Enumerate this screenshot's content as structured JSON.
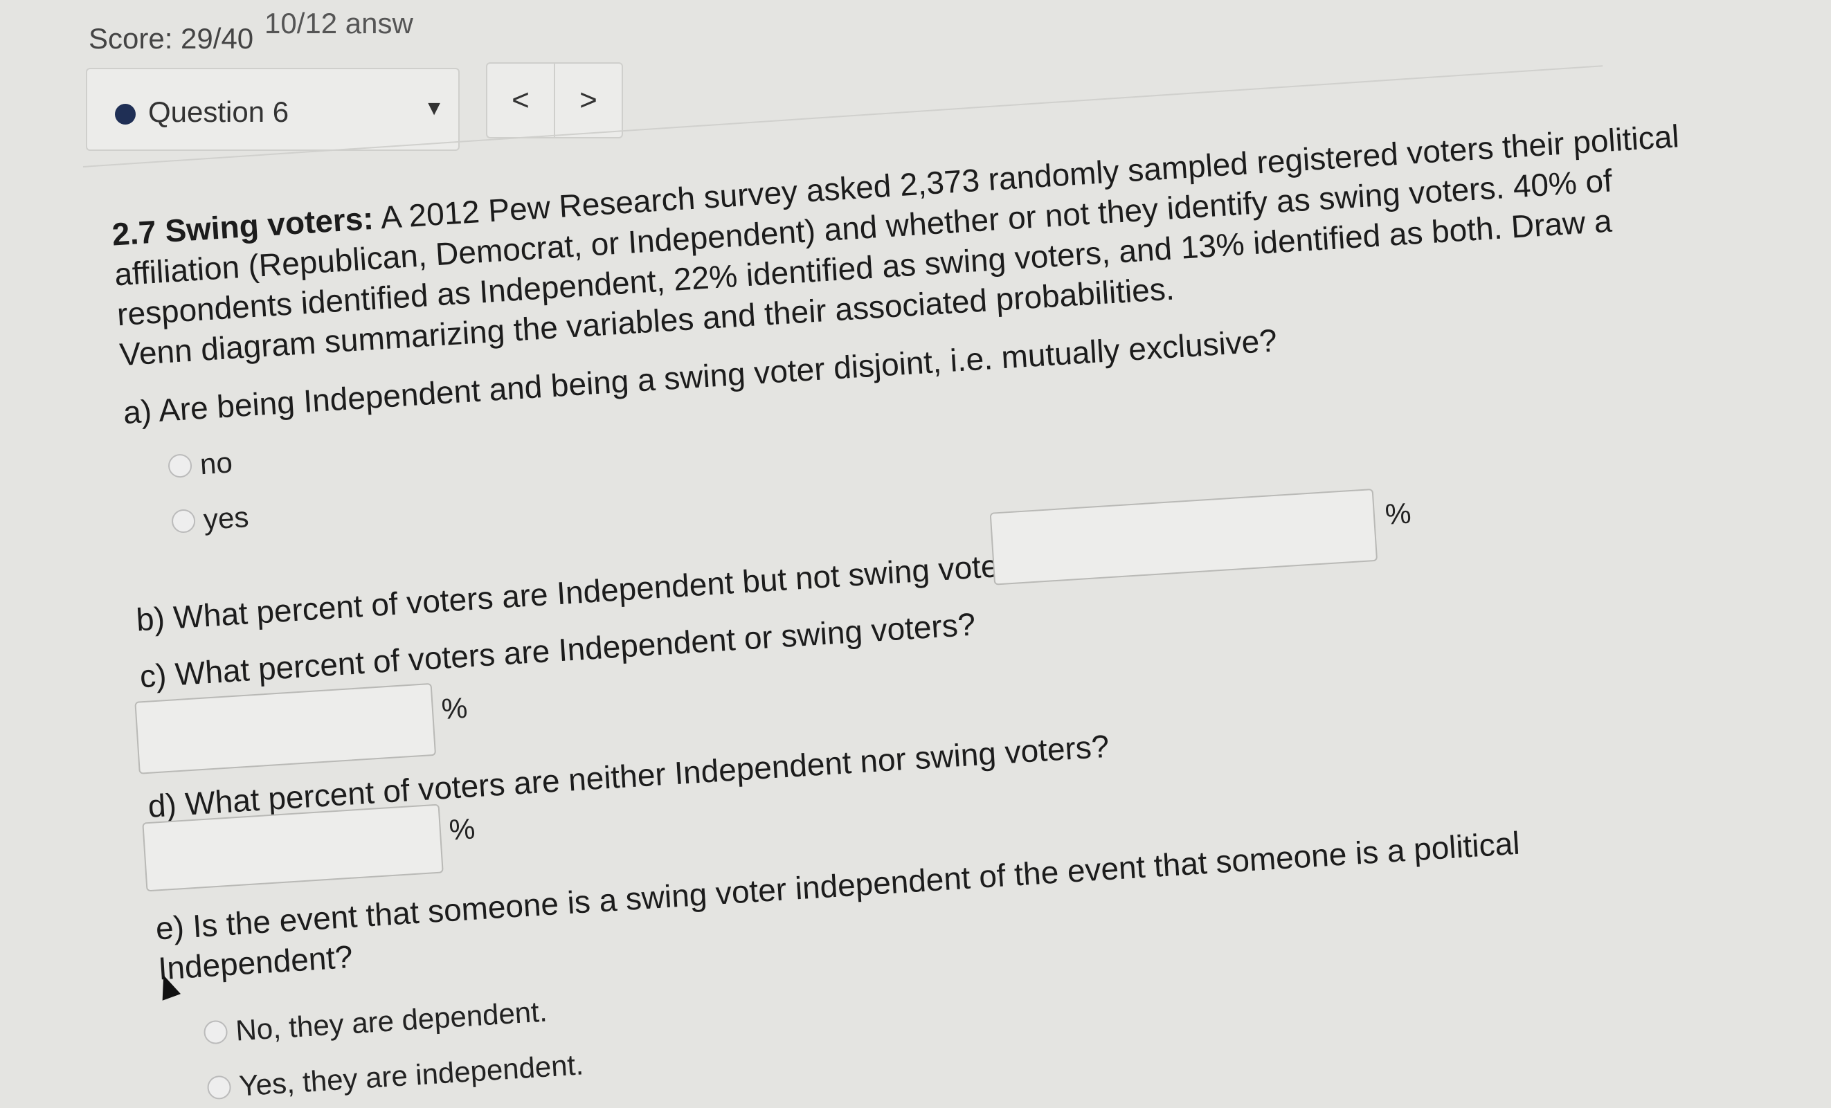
{
  "header": {
    "score": "Score: 29/40",
    "answered": "10/12 answ",
    "question_selector": "Question 6",
    "prev_label": "<",
    "next_label": ">"
  },
  "problem": {
    "heading": "2.7 Swing voters:",
    "text_1": "A 2012 Pew Research survey asked 2,373 randomly sampled registered voters their political affiliation (Republican, Democrat, or Independent) and whether or not they identify as swing voters. 40% of respondents identified as Independent, 22% identified as swing voters, and 13% identified as both. Draw a Venn diagram summarizing the variables and their associated probabilities."
  },
  "part_a": {
    "question": "a) Are being Independent and being a swing voter disjoint, i.e. mutually exclusive?",
    "options": [
      "no",
      "yes"
    ]
  },
  "part_b": {
    "question": "b) What percent of voters are Independent but not swing voters?",
    "unit": "%"
  },
  "part_c": {
    "question": "c) What percent of voters are Independent or swing voters?",
    "unit": "%"
  },
  "part_d": {
    "question": "d) What percent of voters are neither Independent nor swing voters?",
    "unit": "%"
  },
  "part_e": {
    "question": "e) Is the event that someone is a swing voter independent of the event that someone is a political Independent?",
    "options": [
      "No, they are dependent.",
      "Yes, they are independent."
    ]
  }
}
